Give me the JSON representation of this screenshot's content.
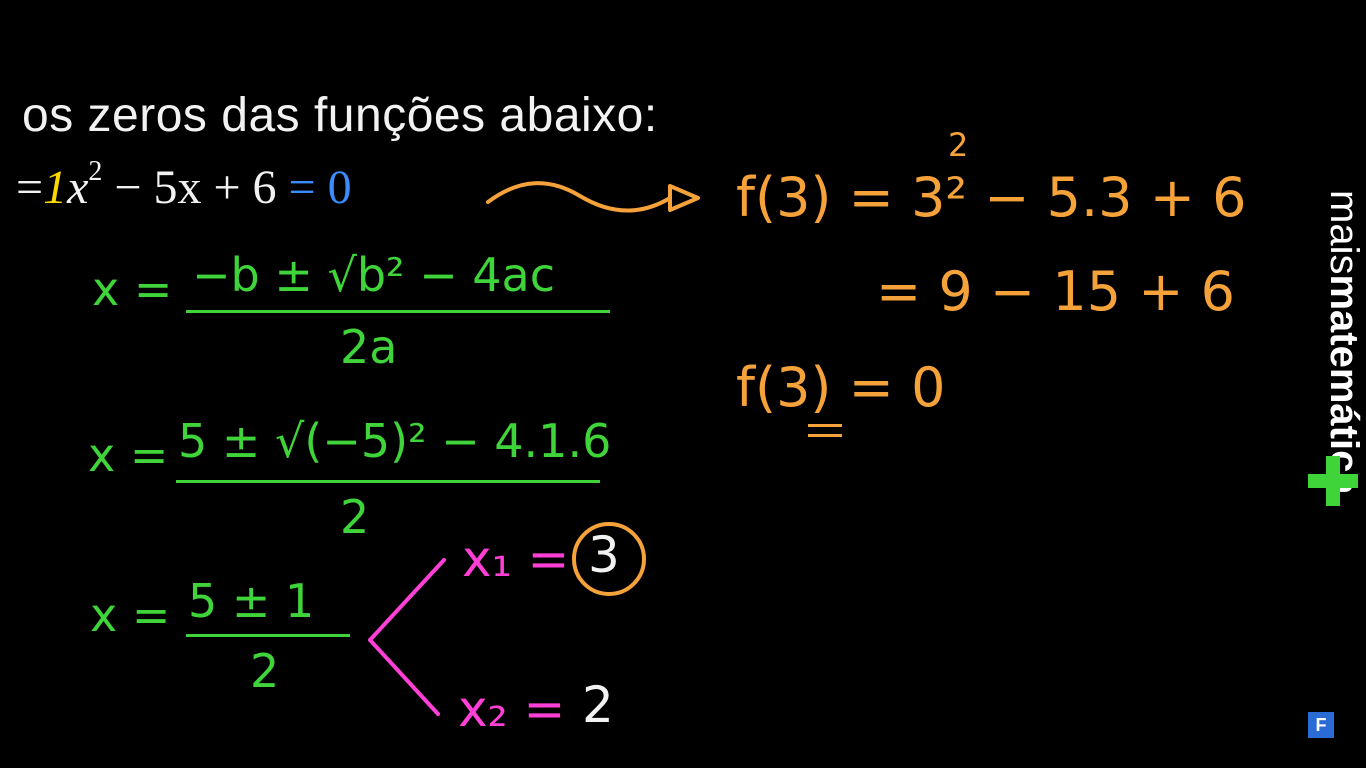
{
  "heading": "os zeros das funções abaixo:",
  "main_equation": {
    "prefix": "=",
    "coef": "1",
    "var": "x",
    "exp": "2",
    "rest": " − 5x + 6 ",
    "eq": "= ",
    "zero": "0"
  },
  "green": {
    "formula_lhs": "x =",
    "formula_num": "−b ± √b² − 4ac",
    "formula_den": "2a",
    "subst_lhs": "x =",
    "subst_num": "5 ± √(−5)² − 4.1.6",
    "subst_den": "2",
    "simpl_lhs": "x =",
    "simpl_num": "5 ± 1",
    "simpl_den": "2"
  },
  "pink": {
    "x1": "x₁ =",
    "x1_value": "3",
    "x2": "x₂ =",
    "x2_value": "2"
  },
  "orange": {
    "line1": "f(3) = 3² − 5.3 + 6",
    "line2": "= 9 − 15 + 6",
    "line3": "f(3) = 0",
    "exp": "2"
  },
  "logo": {
    "light": "mais",
    "bold": "matemática"
  },
  "badge": "F",
  "colors": {
    "background": "#000000",
    "text": "#f2f2f2",
    "green": "#3fd43a",
    "orange": "#f5a23a",
    "pink": "#ff3fd6",
    "blue": "#3b8cff",
    "yellow": "#ffd700"
  }
}
